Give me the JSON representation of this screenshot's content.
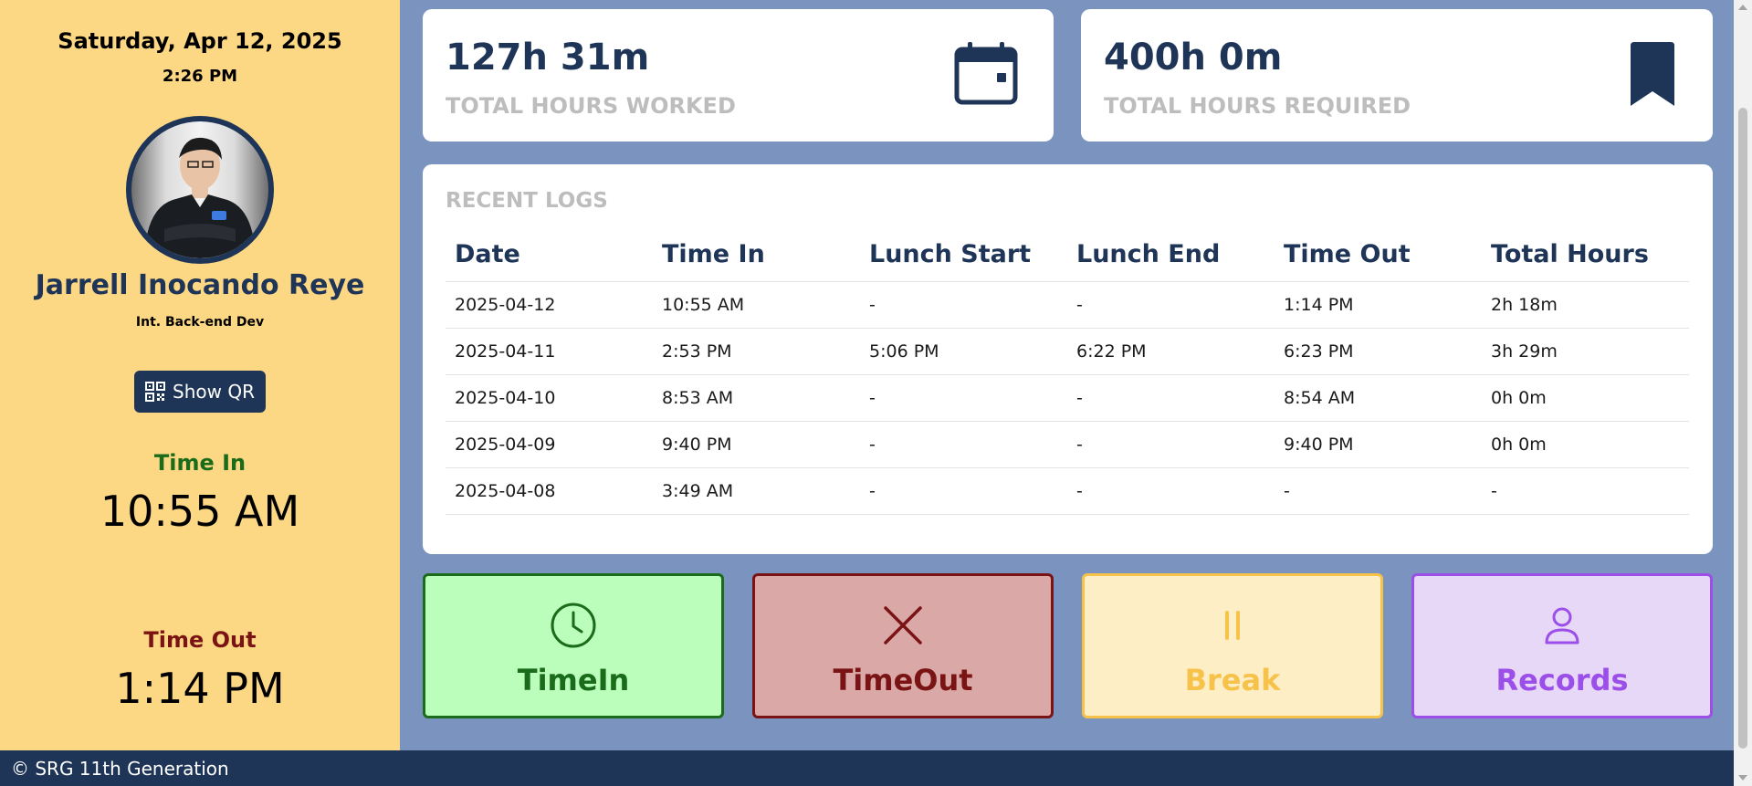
{
  "sidebar": {
    "date": "Saturday, Apr 12, 2025",
    "time": "2:26 PM",
    "name": "Jarrell Inocando Reye",
    "role": "Int. Back-end Dev",
    "qr_button": "Show QR",
    "time_in_label": "Time In",
    "time_in_value": "10:55 AM",
    "time_out_label": "Time Out",
    "time_out_value": "1:14 PM"
  },
  "stats": {
    "worked": {
      "value": "127h 31m",
      "label": "TOTAL HOURS WORKED",
      "icon": "calendar-icon"
    },
    "required": {
      "value": "400h 0m",
      "label": "TOTAL HOURS REQUIRED",
      "icon": "bookmark-icon"
    }
  },
  "logs": {
    "title": "RECENT LOGS",
    "columns": [
      "Date",
      "Time In",
      "Lunch Start",
      "Lunch End",
      "Time Out",
      "Total Hours"
    ],
    "rows": [
      [
        "2025-04-12",
        "10:55 AM",
        "-",
        "-",
        "1:14 PM",
        "2h 18m"
      ],
      [
        "2025-04-11",
        "2:53 PM",
        "5:06 PM",
        "6:22 PM",
        "6:23 PM",
        "3h 29m"
      ],
      [
        "2025-04-10",
        "8:53 AM",
        "-",
        "-",
        "8:54 AM",
        "0h 0m"
      ],
      [
        "2025-04-09",
        "9:40 PM",
        "-",
        "-",
        "9:40 PM",
        "0h 0m"
      ],
      [
        "2025-04-08",
        "3:49 AM",
        "-",
        "-",
        "-",
        "-"
      ]
    ]
  },
  "actions": [
    {
      "label": "TimeIn",
      "icon": "clock-icon",
      "bg": "#bbfebb",
      "border": "#1a6b1a",
      "color": "#1a6b1a"
    },
    {
      "label": "TimeOut",
      "icon": "x-icon",
      "bg": "#dba8a8",
      "border": "#7a1414",
      "color": "#7a1414"
    },
    {
      "label": "Break",
      "icon": "pause-icon",
      "bg": "#feeec6",
      "border": "#f7c24a",
      "color": "#f7c24a"
    },
    {
      "label": "Records",
      "icon": "user-icon",
      "bg": "#e8d8f7",
      "border": "#9b4fe8",
      "color": "#9b4fe8"
    }
  ],
  "footer": {
    "text": "© SRG 11th Generation"
  }
}
